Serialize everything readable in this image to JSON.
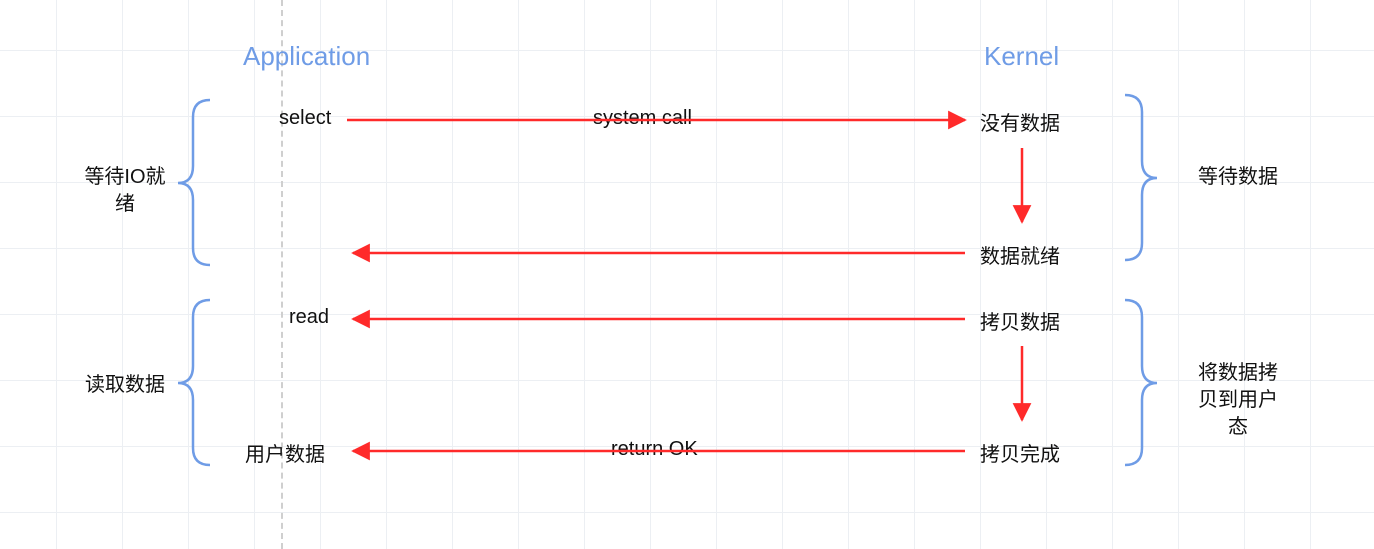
{
  "headings": {
    "application": "Application",
    "kernel": "Kernel"
  },
  "left_brackets": {
    "top_label": "等待IO就\n绪",
    "bottom_label": "读取数据"
  },
  "right_brackets": {
    "top_label": "等待数据",
    "bottom_label": "将数据拷\n贝到用户\n态"
  },
  "app_side": {
    "select": "select",
    "read": "read",
    "user_data": "用户数据"
  },
  "kernel_side": {
    "no_data": "没有数据",
    "data_ready": "数据就绪",
    "copy_data": "拷贝数据",
    "copy_done": "拷贝完成"
  },
  "arrows": {
    "system_call": "system call",
    "return_ok": "return OK"
  },
  "colors": {
    "arrow": "#ff2a2a",
    "brace": "#6f9ce6",
    "heading": "#6f9ce6"
  }
}
